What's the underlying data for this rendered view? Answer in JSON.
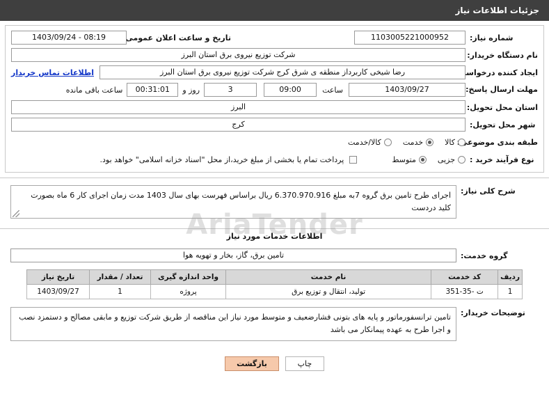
{
  "header": {
    "title": "جزئیات اطلاعات نیاز"
  },
  "watermark": "AriaTender",
  "form": {
    "need_number_label": "شماره نیاز:",
    "need_number_value": "1103005221000952",
    "announce_datetime_label": "تاریخ و ساعت اعلان عمومی:",
    "announce_datetime_value": "1403/09/24 - 08:19",
    "buyer_org_label": "نام دستگاه خریدار:",
    "buyer_org_value": "شرکت توزیع نیروی برق استان البرز",
    "requester_label": "ایجاد کننده درخواست:",
    "requester_value": "رضا شیخی کاربرداز منطقه ی شرق کرج شرکت توزیع نیروی برق استان البرز",
    "contact_link": "اطلاعات تماس خریدار",
    "deadline_label": "مهلت ارسال پاسخ: تا تاریخ:",
    "deadline_date": "1403/09/27",
    "deadline_time_label": "ساعت",
    "deadline_time": "09:00",
    "days_value": "3",
    "days_label": "روز و",
    "remaining_time": "00:31:01",
    "remaining_label": "ساعت باقی مانده",
    "province_label": "استان محل تحویل:",
    "province_value": "البرز",
    "city_label": "شهر محل تحویل:",
    "city_value": "کرج",
    "category_label": "طبقه بندی موضوعی:",
    "category_options": [
      {
        "label": "کالا",
        "selected": false
      },
      {
        "label": "خدمت",
        "selected": true
      },
      {
        "label": "کالا/خدمت",
        "selected": false
      }
    ],
    "process_label": "نوع فرآیند خرید :",
    "process_options": [
      {
        "label": "جزیی",
        "selected": false
      },
      {
        "label": "متوسط",
        "selected": true
      }
    ],
    "payment_note": "پرداخت تمام یا بخشی از مبلغ خرید،از محل \"اسناد خزانه اسلامی\" خواهد بود."
  },
  "summary": {
    "label": "شرح کلی نیاز:",
    "text": "اجرای طرح تامین برق گروه 7به مبلغ 6.370.970.916 ریال براساس فهرست بهای سال 1403 مدت زمان اجرای کار 6 ماه بصورت کلید دردست"
  },
  "services_section": {
    "title": "اطلاعات خدمات مورد نیاز"
  },
  "service_group": {
    "label": "گروه خدمت:",
    "value": "تامین برق، گاز، بخار و تهویه هوا"
  },
  "table": {
    "columns": [
      "ردیف",
      "کد خدمت",
      "نام خدمت",
      "واحد اندازه گیری",
      "تعداد / مقدار",
      "تاریخ نیاز"
    ],
    "rows": [
      {
        "row": "1",
        "code": "ت -35-351",
        "name": "تولید، انتقال و توزیع برق",
        "unit": "پروژه",
        "qty": "1",
        "date": "1403/09/27"
      }
    ]
  },
  "buyer_notes": {
    "label": "توضیحات خریدار:",
    "text": "تامین ترانسفورماتور و پایه های بتونی فشارضعیف و متوسط مورد نیاز این مناقصه از طریق شرکت توزیع و مابقی مصالح و دستمزد نصب و اجرا طرح به عهده پیمانکار می باشد"
  },
  "buttons": {
    "print": "چاپ",
    "back": "بازگشت"
  }
}
